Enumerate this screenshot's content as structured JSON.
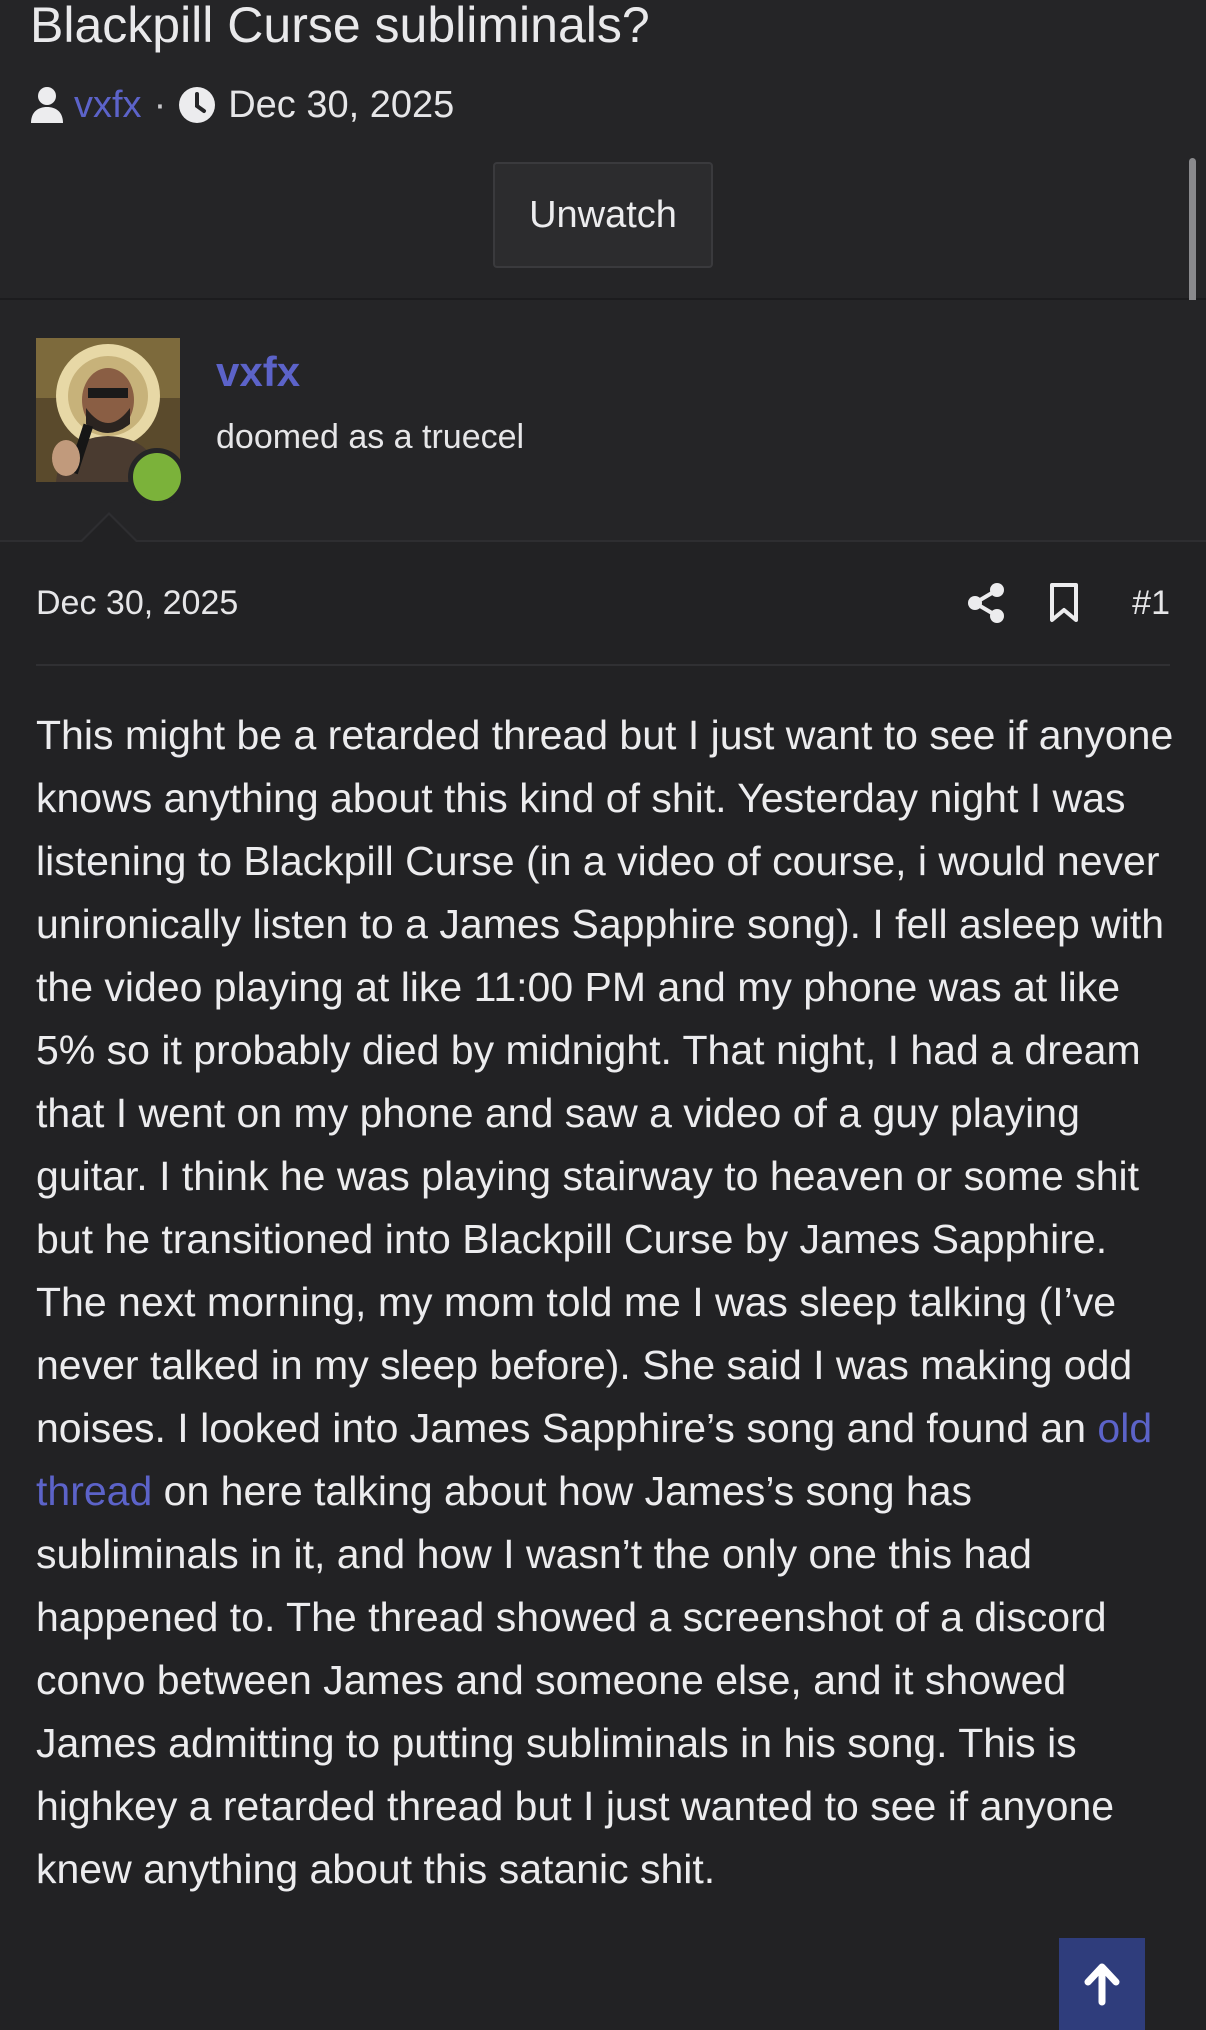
{
  "thread": {
    "title": "Blackpill Curse subliminals?",
    "author": "vxfx",
    "separator": "·",
    "date": "Dec 30, 2025",
    "unwatch_label": "Unwatch"
  },
  "user": {
    "name": "vxfx",
    "title": "doomed as a truecel",
    "online": true,
    "avatar_icon": "avatar-photo"
  },
  "post": {
    "date": "Dec 30, 2025",
    "number": "#1",
    "body_before_link": "This might be a retarded thread but I just want to see if anyone knows anything about this kind of shit. Yesterday night I was listening to Blackpill Curse (in a video of course, i would never unironically listen to a James Sapphire song). I fell asleep with the video playing at like 11:00 PM and my phone was at like 5% so it probably died by midnight. That night, I had a dream that I went on my phone and saw a video of a guy playing guitar. I think he was playing stairway to heaven or some shit but he transitioned into Blackpill Curse by James Sapphire. The next morning, my mom told me I was sleep talking (I’ve never talked in my sleep before). She said I was making odd noises. I looked into James Sapphire’s song and found an ",
    "link_text": "old thread",
    "body_after_link": " on here talking about how James’s song has subliminals in it, and how I wasn’t the only one this had happened to. The thread showed a screenshot of a discord convo between James and someone else, and it showed James admitting to putting subliminals in his song. This is highkey a retarded thread but I just wanted to see if anyone knew anything about this satanic shit."
  },
  "icons": {
    "author": "user-icon",
    "date": "clock-icon",
    "share": "share-icon",
    "bookmark": "bookmark-icon",
    "scroll_top": "arrow-up-icon"
  },
  "colors": {
    "background": "#222224",
    "link": "#5c63c9",
    "online": "#7bb23a",
    "scroll_top_button": "#2f3d7c"
  }
}
